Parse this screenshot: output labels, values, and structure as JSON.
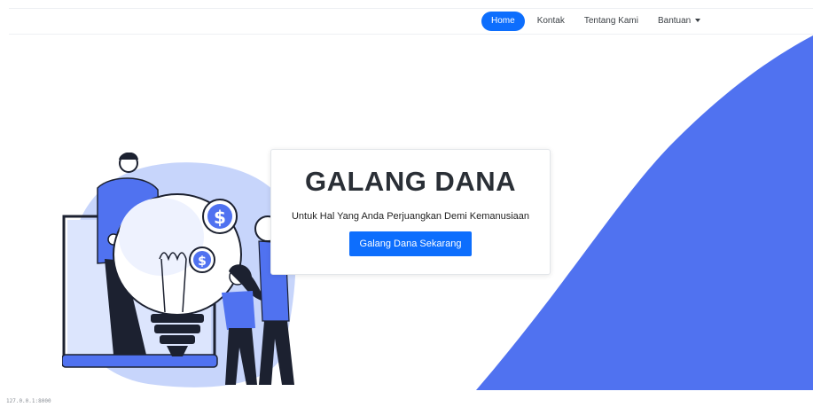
{
  "nav": {
    "items": [
      {
        "label": "Home",
        "active": true
      },
      {
        "label": "Kontak",
        "active": false
      },
      {
        "label": "Tentang Kami",
        "active": false
      },
      {
        "label": "Bantuan",
        "active": false,
        "dropdown": true
      }
    ]
  },
  "hero": {
    "title": "GALANG DANA",
    "subtitle": "Untuk Hal Yang Anda Perjuangkan Demi Kemanusiaan",
    "cta_label": "Galang Dana Sekarang"
  },
  "illustration": {
    "coin_symbol": "$"
  },
  "colors": {
    "primary": "#0d6efd",
    "wave": "#5072f0",
    "illustration_bg": "#c7d5fb"
  },
  "footer": {
    "url": "127.0.0.1:8000"
  }
}
